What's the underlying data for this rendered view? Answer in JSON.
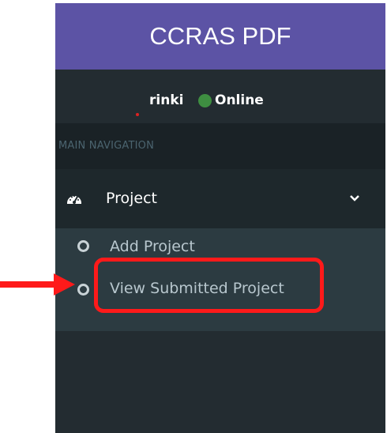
{
  "app": {
    "brand_title": "CCRAS PDF"
  },
  "user_panel": {
    "username": "rinki",
    "status_label": "Online",
    "status_color": "#3e8e41"
  },
  "navigation": {
    "header": "MAIN NAVIGATION",
    "items": [
      {
        "label": "Project",
        "icon": "dashboard-icon",
        "expanded": true,
        "children": [
          {
            "label": "Add Project",
            "icon": "circle-icon"
          },
          {
            "label": "View Submitted Project",
            "icon": "circle-icon"
          }
        ]
      }
    ]
  },
  "annotation": {
    "highlight_color": "#ff1a1a",
    "highlighted_item": "View Submitted Project"
  },
  "colors": {
    "brand_bg": "#5c53a5",
    "sidebar_bg": "#232c31",
    "header_bg": "#1a2226",
    "submenu_bg": "#2c3b41"
  }
}
